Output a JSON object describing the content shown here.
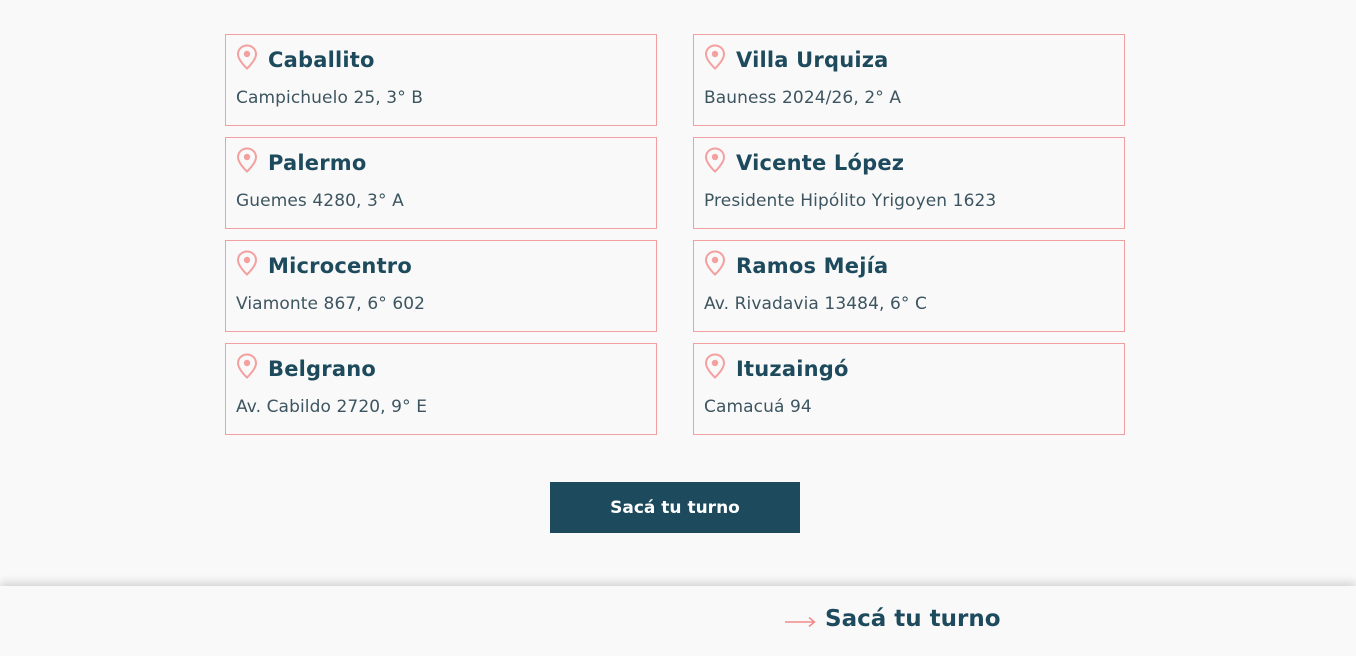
{
  "locations": [
    {
      "name": "Caballito",
      "address": "Campichuelo 25, 3° B"
    },
    {
      "name": "Villa Urquiza",
      "address": "Bauness 2024/26, 2° A"
    },
    {
      "name": "Palermo",
      "address": "Guemes 4280, 3° A"
    },
    {
      "name": "Vicente López",
      "address": "Presidente Hipólito Yrigoyen 1623"
    },
    {
      "name": "Microcentro",
      "address": "Viamonte 867, 6° 602"
    },
    {
      "name": "Ramos Mejía",
      "address": "Av. Rivadavia 13484, 6° C"
    },
    {
      "name": "Belgrano",
      "address": "Av. Cabildo 2720, 9° E"
    },
    {
      "name": "Ituzaingó",
      "address": "Camacuá 94"
    }
  ],
  "cta": {
    "label": "Sacá tu turno"
  },
  "footer": {
    "link_label": "Sacá tu turno"
  },
  "icons": {
    "pin": "map-pin-icon",
    "arrow": "arrow-right-icon"
  },
  "colors": {
    "primary": "#1d4a5c",
    "accent": "#f0a0a0",
    "background": "#f9f9f9",
    "text": "#3d5560"
  }
}
